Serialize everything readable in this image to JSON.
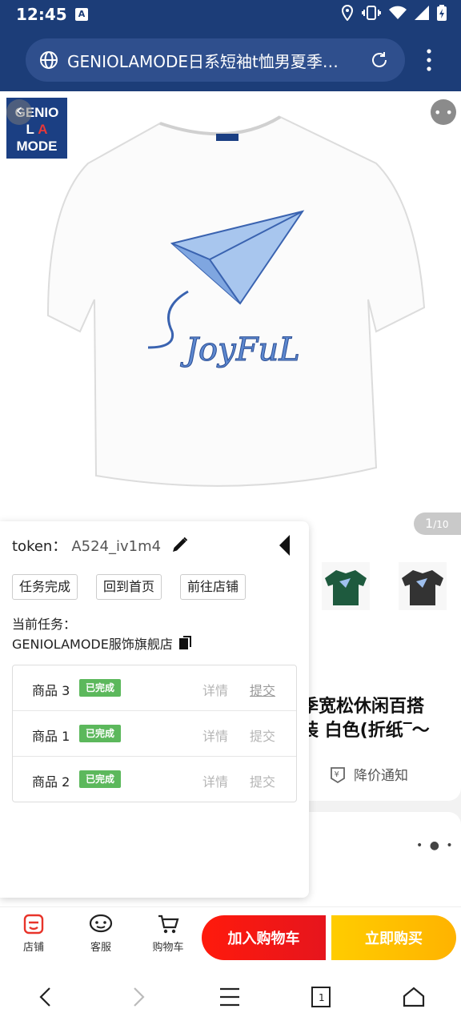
{
  "status": {
    "time": "12:45",
    "a_icon": "A"
  },
  "browser": {
    "url_title": "GENIOLAMODE日系短袖t恤男夏季…"
  },
  "logo": {
    "line1": "GENIO",
    "line2a": "L",
    "line2b": "A",
    "line3": "MODE"
  },
  "gallery": {
    "counter_current": "1",
    "counter_total": "/10"
  },
  "product": {
    "title_line1": "季宽松休闲百搭",
    "title_line2": "装 白色(折纸‾〜",
    "price_notice": "降价通知",
    "price_icon_char": "¥"
  },
  "actions": {
    "store": "店铺",
    "service": "客服",
    "cart": "购物车",
    "add_to_cart": "加入购物车",
    "buy_now": "立即购买"
  },
  "panel": {
    "token_label": "token：",
    "token_value": "A524_iv1m4",
    "btn_done": "任务完成",
    "btn_home": "回到首页",
    "btn_store": "前往店铺",
    "current_task_label": "当前任务：",
    "current_task_shop": "GENIOLAMODE服饰旗舰店",
    "tasks": [
      {
        "name": "商品 3",
        "status": "已完成",
        "detail": "详情",
        "submit": "提交"
      },
      {
        "name": "商品 1",
        "status": "已完成",
        "detail": "详情",
        "submit": "提交"
      },
      {
        "name": "商品 2",
        "status": "已完成",
        "detail": "详情",
        "submit": "提交"
      }
    ]
  },
  "nav": {
    "tabs_count": "1"
  },
  "colors": {
    "header": "#1c3d78",
    "cart_red": "#ff1a0c",
    "buy_yellow": "#ffc300",
    "badge_green": "#5cb85c"
  }
}
